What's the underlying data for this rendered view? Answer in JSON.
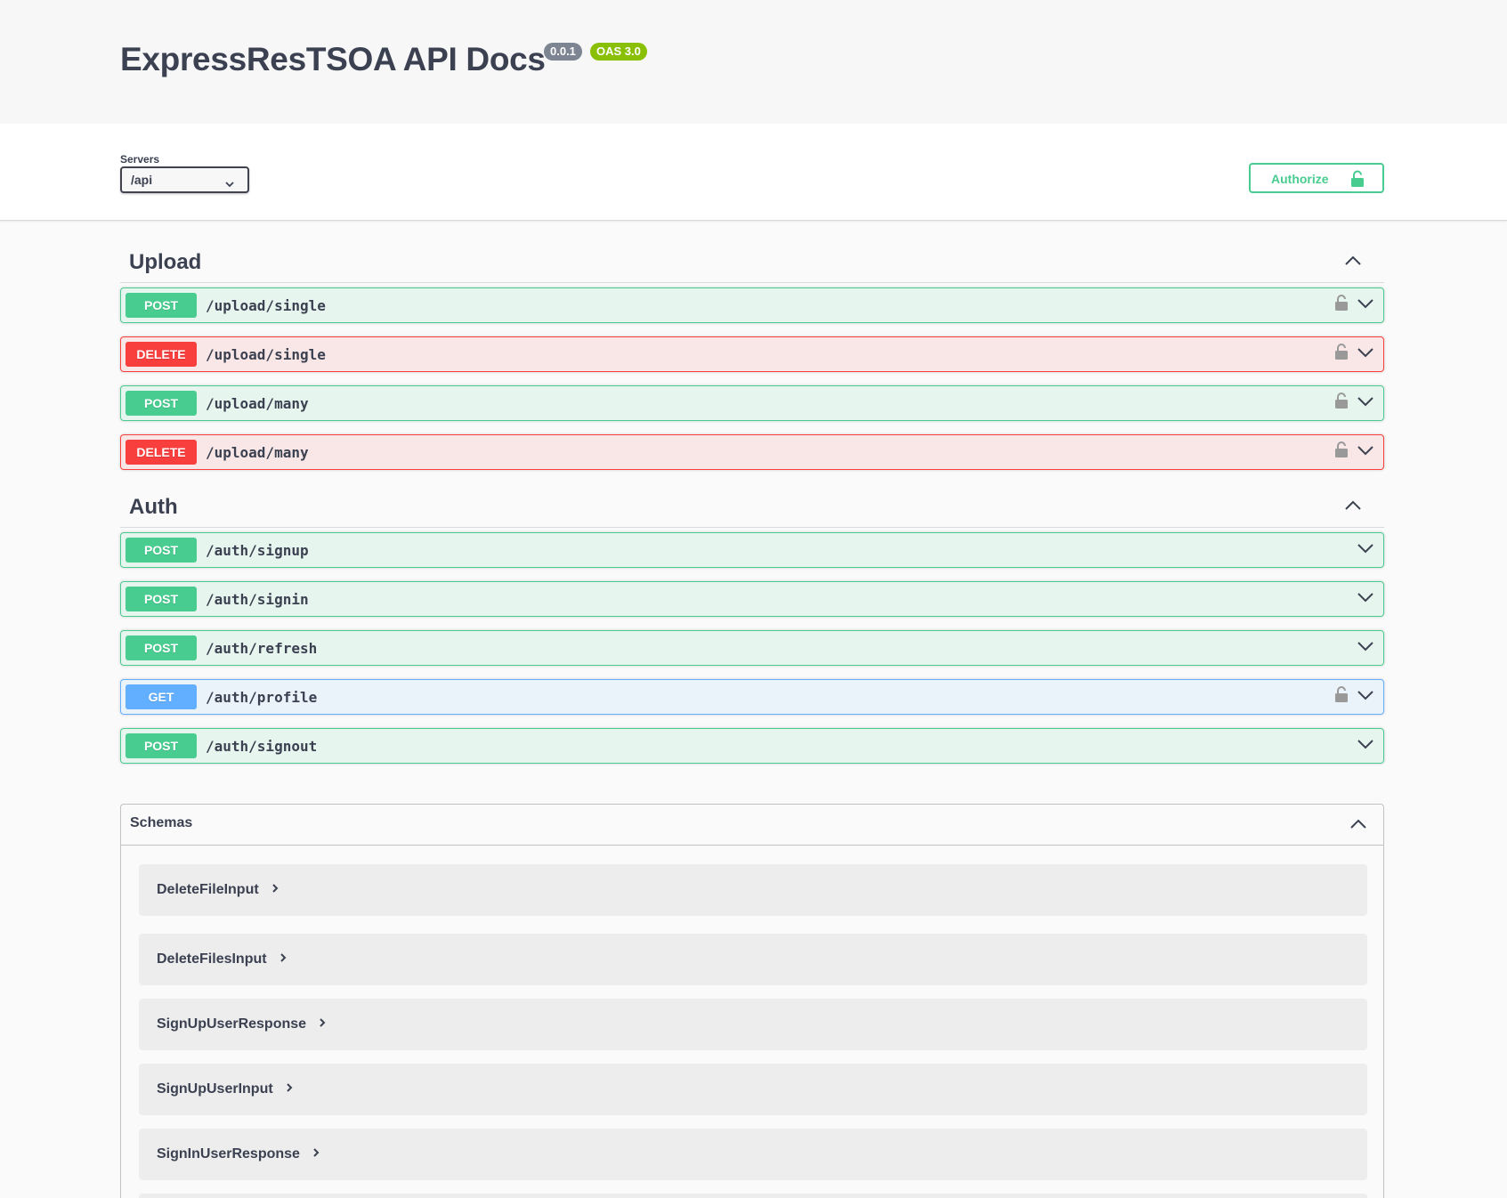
{
  "header": {
    "title": "ExpressResTSOA API Docs",
    "version_badge": "0.0.1",
    "oas_badge": "OAS 3.0"
  },
  "servers": {
    "label": "Servers",
    "selected": "/api"
  },
  "authorize": {
    "label": "Authorize"
  },
  "tags": [
    {
      "name": "Upload",
      "operations": [
        {
          "method": "POST",
          "path": "/upload/single",
          "locked": true
        },
        {
          "method": "DELETE",
          "path": "/upload/single",
          "locked": true
        },
        {
          "method": "POST",
          "path": "/upload/many",
          "locked": true
        },
        {
          "method": "DELETE",
          "path": "/upload/many",
          "locked": true
        }
      ]
    },
    {
      "name": "Auth",
      "operations": [
        {
          "method": "POST",
          "path": "/auth/signup",
          "locked": false
        },
        {
          "method": "POST",
          "path": "/auth/signin",
          "locked": false
        },
        {
          "method": "POST",
          "path": "/auth/refresh",
          "locked": false
        },
        {
          "method": "GET",
          "path": "/auth/profile",
          "locked": true
        },
        {
          "method": "POST",
          "path": "/auth/signout",
          "locked": false
        }
      ]
    }
  ],
  "schemas": {
    "title": "Schemas",
    "items": [
      "DeleteFileInput",
      "DeleteFilesInput",
      "SignUpUserResponse",
      "SignUpUserInput",
      "SignInUserResponse"
    ]
  },
  "colors": {
    "post": "#49cc90",
    "delete": "#f93e3e",
    "get": "#61affe",
    "badge_version": "#7d8492",
    "badge_oas": "#89bf04"
  }
}
